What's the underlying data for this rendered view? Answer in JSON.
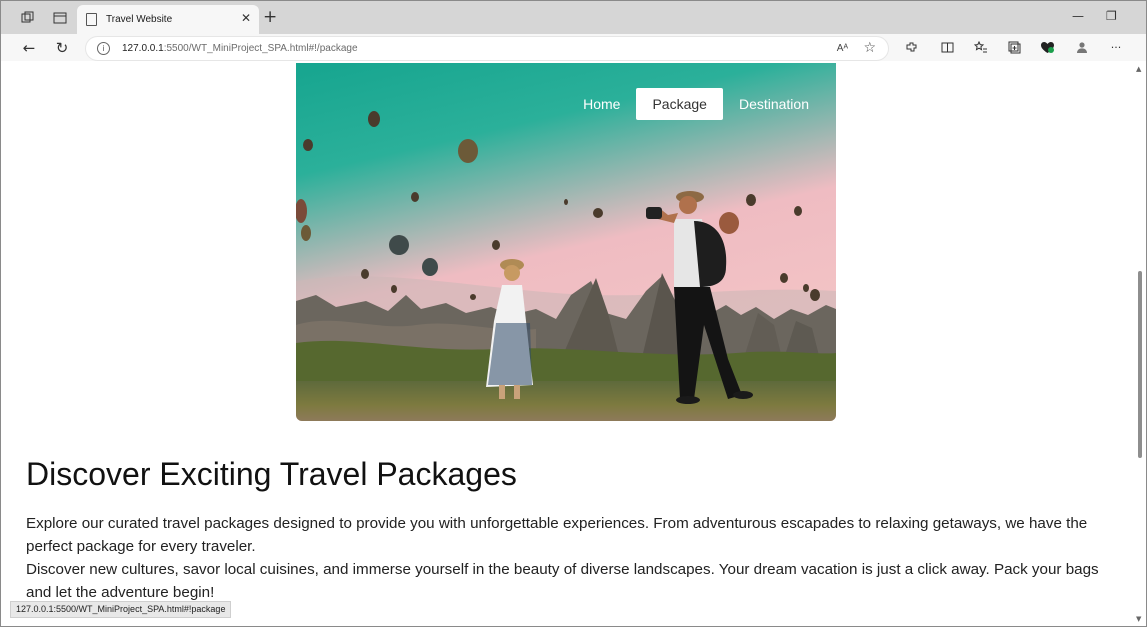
{
  "browser": {
    "tab_title": "Travel Website",
    "url_host": "127.0.0.1",
    "url_rest": ":5500/WT_MiniProject_SPA.html#!/package",
    "read_aloud_label": "Aᴬ",
    "status_url": "127.0.0.1:5500/WT_MiniProject_SPA.html#!package"
  },
  "icons": {
    "workspaces": "workspaces-icon",
    "tab_actions": "tab-actions-icon",
    "page": "page-icon",
    "close": "✕",
    "new_tab": "+",
    "minimize": "—",
    "restore": "❐",
    "back": "←",
    "refresh": "↻",
    "favorite": "☆",
    "more": "···"
  },
  "site_nav": {
    "items": [
      {
        "label": "Home",
        "active": false
      },
      {
        "label": "Package",
        "active": true
      },
      {
        "label": "Destination",
        "active": false
      }
    ]
  },
  "content": {
    "heading": "Discover Exciting Travel Packages",
    "paragraph_1": "Explore our curated travel packages designed to provide you with unforgettable experiences. From adventurous escapades to relaxing getaways, we have the perfect package for every traveler.",
    "paragraph_2": "Discover new cultures, savor local cuisines, and immerse yourself in the beauty of diverse landscapes. Your dream vacation is just a click away. Pack your bags and let the adventure begin!"
  },
  "colors": {
    "sky_top": "#1aa892",
    "sky_bottom": "#f2b8bd",
    "rock": "#5e5a52",
    "grass": "#6f7d3a"
  }
}
